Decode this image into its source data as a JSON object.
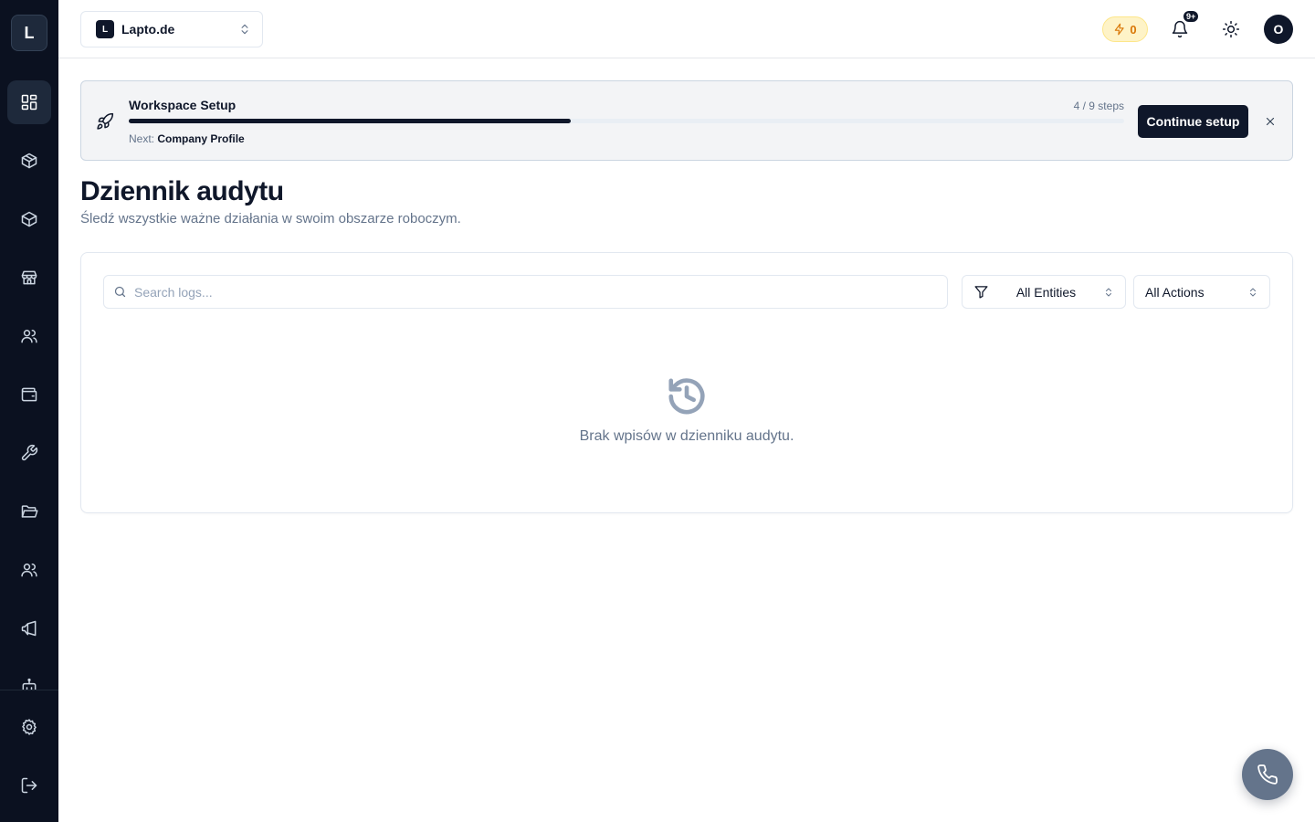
{
  "app": {
    "logo_letter": "L"
  },
  "sidebar": {
    "items": [
      {
        "icon": "dashboard-icon",
        "active": true
      },
      {
        "icon": "box-icon"
      },
      {
        "icon": "package-icon"
      },
      {
        "icon": "store-icon"
      },
      {
        "icon": "users-icon"
      },
      {
        "icon": "wallet-icon"
      },
      {
        "icon": "wrench-icon"
      },
      {
        "icon": "folder-icon"
      },
      {
        "icon": "team-icon"
      },
      {
        "icon": "megaphone-icon"
      },
      {
        "icon": "bot-icon"
      }
    ],
    "bottom": [
      {
        "icon": "settings-icon"
      },
      {
        "icon": "logout-icon"
      }
    ]
  },
  "header": {
    "workspace_initial": "L",
    "workspace_name": "Lapto.de",
    "credits": "0",
    "notifications_badge": "9+",
    "avatar_initial": "O"
  },
  "setup_banner": {
    "title": "Workspace Setup",
    "steps_text": "4 / 9 steps",
    "progress_fraction": 0.444,
    "next_label": "Next:",
    "next_step": "Company Profile",
    "continue_label": "Continue setup"
  },
  "page": {
    "title": "Dziennik audytu",
    "subtitle": "Śledź wszystkie ważne działania w swoim obszarze roboczym."
  },
  "filters": {
    "search_placeholder": "Search logs...",
    "entities_value": "All Entities",
    "actions_value": "All Actions"
  },
  "empty_state": {
    "message": "Brak wpisów w dzienniku audytu."
  },
  "colors": {
    "sidebar_bg": "#0b1120",
    "primary": "#0f172a",
    "credits_accent": "#d97706",
    "fab_bg": "#64748b"
  }
}
